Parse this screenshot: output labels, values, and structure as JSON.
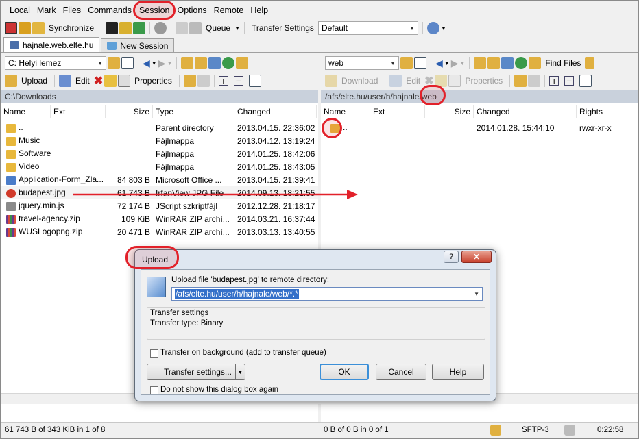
{
  "menu": [
    "Local",
    "Mark",
    "Files",
    "Commands",
    "Session",
    "Options",
    "Remote",
    "Help"
  ],
  "toolbar": {
    "synchronize": "Synchronize",
    "queue": "Queue",
    "transfer_settings": "Transfer Settings",
    "transfer_default": "Default"
  },
  "tabs": [
    {
      "label": "hajnale.web.elte.hu"
    },
    {
      "label": "New Session"
    }
  ],
  "left": {
    "drive": "C: Helyi lemez",
    "upload": "Upload",
    "edit": "Edit",
    "properties": "Properties",
    "path": "C:\\Downloads",
    "columns": [
      "Name",
      "Ext",
      "Size",
      "Type",
      "Changed"
    ],
    "rows": [
      {
        "name": "..",
        "size": "",
        "type": "Parent directory",
        "changed": "2013.04.15.  22:36:02",
        "icon": "folder"
      },
      {
        "name": "Music",
        "size": "",
        "type": "Fájlmappa",
        "changed": "2013.04.12.  13:19:24",
        "icon": "folder"
      },
      {
        "name": "Software",
        "size": "",
        "type": "Fájlmappa",
        "changed": "2014.01.25.  18:42:06",
        "icon": "folder"
      },
      {
        "name": "Video",
        "size": "",
        "type": "Fájlmappa",
        "changed": "2014.01.25.  18:43:05",
        "icon": "folder"
      },
      {
        "name": "Application-Form_Zla...",
        "size": "84 803 B",
        "type": "Microsoft Office ...",
        "changed": "2013.04.15.  21:39:41",
        "icon": "doc"
      },
      {
        "name": "budapest.jpg",
        "size": "61 743 B",
        "type": "IrfanView JPG File",
        "changed": "2014.09.13.  18:21:55",
        "icon": "jpg"
      },
      {
        "name": "jquery.min.js",
        "size": "72 174 B",
        "type": "JScript szkriptfájl",
        "changed": "2012.12.28.  21:18:17",
        "icon": "js"
      },
      {
        "name": "travel-agency.zip",
        "size": "109 KiB",
        "type": "WinRAR ZIP archí...",
        "changed": "2014.03.21.  16:37:44",
        "icon": "zip"
      },
      {
        "name": "WUSLogopng.zip",
        "size": "20 471 B",
        "type": "WinRAR ZIP archí...",
        "changed": "2013.03.13.  13:40:55",
        "icon": "zip"
      }
    ],
    "status": "61 743 B of 343 KiB in 1 of 8"
  },
  "right": {
    "drive": "web",
    "find_files": "Find Files",
    "download": "Download",
    "edit": "Edit",
    "properties": "Properties",
    "path": "/afs/elte.hu/user/h/hajnale/web",
    "columns": [
      "Name",
      "Ext",
      "Size",
      "Changed",
      "Rights"
    ],
    "rows": [
      {
        "name": "..",
        "changed": "2014.01.28.  15:44:10",
        "rights": "rwxr-xr-x"
      }
    ],
    "status": "0 B of 0 B in 0 of 1"
  },
  "dialog": {
    "title": "Upload",
    "help_glyph": "?",
    "message": "Upload file 'budapest.jpg' to remote directory:",
    "target": "/afs/elte.hu/user/h/hajnale/web/*.*",
    "settings_title": "Transfer settings",
    "transfer_type": "Transfer type: Binary",
    "background": "Transfer on background (add to transfer queue)",
    "settings_btn": "Transfer settings...",
    "ok": "OK",
    "cancel": "Cancel",
    "help": "Help",
    "dont_show": "Do not show this dialog box again"
  },
  "statusbar": {
    "protocol": "SFTP-3",
    "time": "0:22:58"
  },
  "colors": {
    "annotation": "#e2212a",
    "arrow": "#e2212a",
    "path_bar": "#c9d1dc",
    "dialog_frame": "#dfe7f1"
  }
}
